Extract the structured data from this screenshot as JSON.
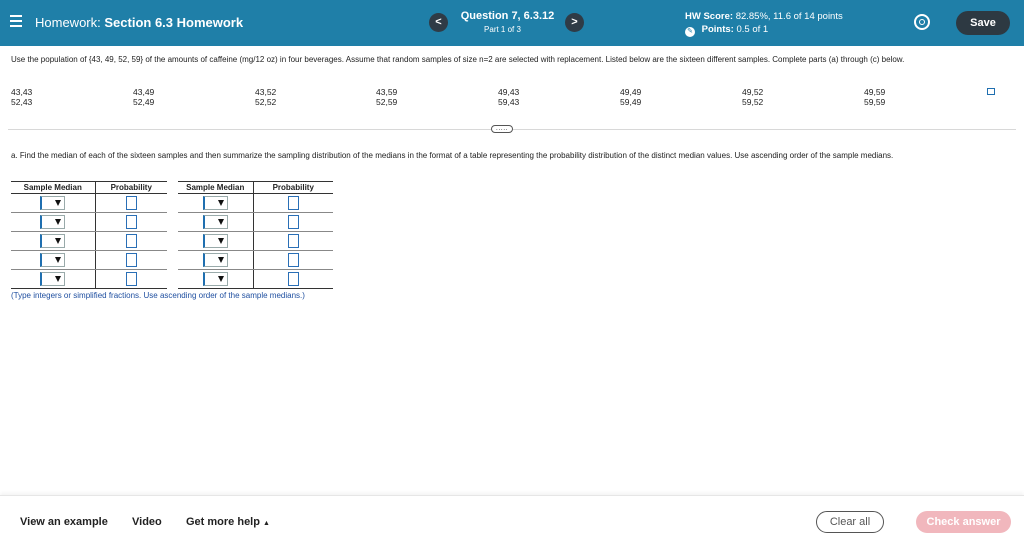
{
  "header": {
    "prefix": "Homework:",
    "title": "Section 6.3 Homework",
    "question_title": "Question 7, 6.3.12",
    "question_sub": "Part 1 of 3",
    "prev_label": "<",
    "next_label": ">",
    "hw_score_label": "HW Score:",
    "hw_score_value": "82.85%, 11.6 of 14 points",
    "points_label": "Points:",
    "points_value": "0.5 of 1",
    "save_label": "Save"
  },
  "problem": {
    "text": "Use the population of {43, 49, 52, 59} of the amounts of caffeine (mg/12 oz) in four beverages. Assume that random samples of size n=2 are selected with replacement. Listed below are the sixteen different samples. Complete parts (a) through (c) below.",
    "samples": [
      [
        "43,43",
        "52,43"
      ],
      [
        "43,49",
        "52,49"
      ],
      [
        "43,52",
        "52,52"
      ],
      [
        "43,59",
        "52,59"
      ],
      [
        "49,43",
        "59,43"
      ],
      [
        "49,49",
        "59,49"
      ],
      [
        "49,52",
        "59,52"
      ],
      [
        "49,59",
        "59,59"
      ]
    ],
    "more_label": "....."
  },
  "part_a": {
    "text": "a. Find the median of each of the sixteen samples and then summarize the sampling distribution of the medians in the format of a table representing the probability distribution of the distinct median values. Use ascending order of the sample medians.",
    "col_median": "Sample Median",
    "col_prob": "Probability",
    "hint": "(Type integers or simplified fractions. Use ascending order of the sample medians.)"
  },
  "footer": {
    "view_example": "View an example",
    "video": "Video",
    "get_help": "Get more help",
    "clear_all": "Clear all",
    "check_answer": "Check answer"
  },
  "colors": {
    "header_bg": "#1f7fa8",
    "save_bg": "#2d3942",
    "check_bg": "#f1b7bd",
    "input_border": "#2a6fb6"
  }
}
